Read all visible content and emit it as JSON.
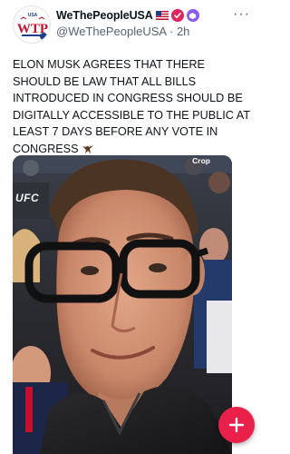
{
  "post": {
    "author_name": "WeThePeopleUSA",
    "handle": "@WeThePeopleUSA",
    "separator": "·",
    "time": "2h",
    "more_label": "···",
    "text": "ELON MUSK AGREES THAT THERE SHOULD BE LAW THAT ALL BILLS INTRODUCED IN CONGRESS SHOULD BE DIGITALLY ACCESSIBLE TO THE PUBLIC AT LEAST 7 DAYS BEFORE ANY VOTE IN CONGRESS",
    "icons": [
      "us-flag-icon",
      "verified-icon",
      "affiliate-badge-icon",
      "eagle-icon"
    ]
  },
  "avatar": {
    "logo_text": "WTP",
    "top_text": "USA"
  },
  "media": {
    "crop_label": "Crop",
    "banner_text": "UFC"
  },
  "fab": {
    "label": "+"
  },
  "colors": {
    "accent": "#e8204a",
    "verified": "#e0245e",
    "affiliate": "#8a5cf6",
    "secondary_text": "#536471"
  }
}
